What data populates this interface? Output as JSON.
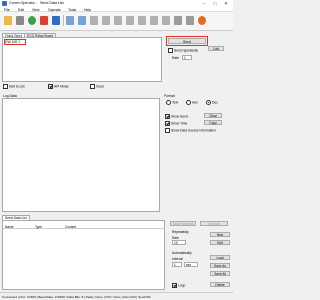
{
  "titlebar": {
    "app_name": "Comm Operator",
    "sep": "-",
    "window_name": "Send Data List",
    "minimize": "–",
    "maximize": "□",
    "close": "✕"
  },
  "menu": [
    "File",
    "Edit",
    "View",
    "Operate",
    "Tools",
    "Help"
  ],
  "toolbar": {
    "icons": [
      "open-icon",
      "tools-icon",
      "play-icon",
      "stop-icon",
      "save-icon",
      "undo-icon",
      "redo-icon",
      "refresh-icon",
      "connect-icon",
      "disconnect-icon",
      "grid-icon",
      "list-icon",
      "send-icon",
      "clear-icon",
      "settings-icon",
      "info-icon",
      "at-icon"
    ]
  },
  "quick_send": {
    "tabs": [
      "Quick Send",
      "ECG Relay Board"
    ],
    "input_value": "DW 100 1",
    "send_label": "Send",
    "send_repeatedly_label": "Send repeatedly",
    "calc_label": "Calc",
    "rate_label": "Rate",
    "rate_value": "1",
    "add_to_list_label": "Add to List",
    "api_mode_label": "API Mode",
    "clear_label": "Clear"
  },
  "log": {
    "title": "Log Data",
    "format_label": "Format",
    "formats": [
      "Text",
      "Hex",
      "Dec"
    ],
    "selected_format": "Dec",
    "show_send_label": "Show Send",
    "show_time_label": "Show Time",
    "show_source_label": "Show Data Source Information",
    "clear_label": "Clear",
    "copy_label": "Copy"
  },
  "send_list": {
    "tab_label": "Send Data List",
    "columns": [
      "Name",
      "Type",
      "Content"
    ],
    "top_buttons": [
      "Send Selected",
      "Send All"
    ],
    "repeatedly_label": "Repeatedly",
    "rate_label": "Rate",
    "rate_value": "10",
    "automatically_label": "Automatically",
    "interval_label": "Interval",
    "interval_value": "1",
    "interval_unit": "sec",
    "loop_label": "Loop",
    "side_buttons": [
      "New",
      "Edit",
      "Load",
      "Save As",
      "Save All",
      "Delete"
    ]
  },
  "statusbar": {
    "text": "Connected | Port: COM3 | Baud Rate: 115200 | Data Bits: 8 | Parity: None | DTC: None | Recv:0/0 | Send:0/0"
  },
  "colors": {
    "accent": "#2d6fc0",
    "highlight": "#e0302a"
  }
}
